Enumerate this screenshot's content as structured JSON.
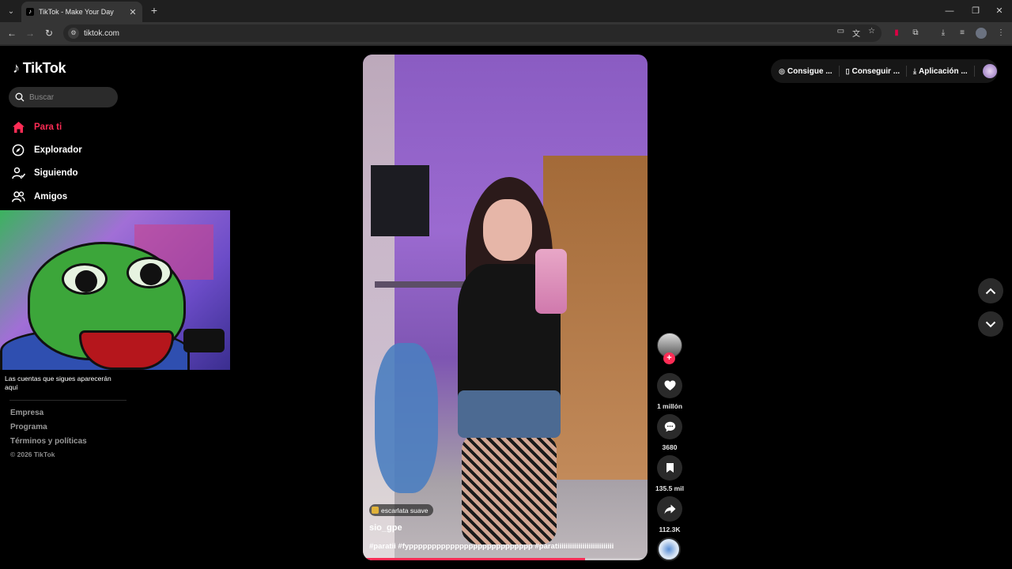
{
  "browser": {
    "tab_title": "TikTok - Make Your Day",
    "url": "tiktok.com",
    "new_tab": "+",
    "tab_close": "✕"
  },
  "sidebar": {
    "logo_text": "TikTok",
    "search_placeholder": "Buscar",
    "nav": [
      {
        "label": "Para ti",
        "icon": "home-icon",
        "active": true
      },
      {
        "label": "Explorador",
        "icon": "compass-icon",
        "active": false
      },
      {
        "label": "Siguiendo",
        "icon": "user-follow-icon",
        "active": false
      },
      {
        "label": "Amigos",
        "icon": "friends-icon",
        "active": false
      }
    ],
    "following_hint": "Las cuentas que sigues aparecerán aquí",
    "footer_links": [
      "Empresa",
      "Programa",
      "Términos y políticas"
    ],
    "copyright": "© 2026 TikTok"
  },
  "video": {
    "sound": "escarlata suave",
    "username": "sio_gpe",
    "caption": "#paratii #fyppppppppppppppppppppppppppp #paratiiiiiiiiiiiiiiiiiiiiiiiiiii",
    "progress": 0.78
  },
  "actions": {
    "likes": "1 millón",
    "comments": "3680",
    "saves": "135.5 mil",
    "shares": "112.3K",
    "follow_symbol": "+"
  },
  "topbar": {
    "coins": "Consigue ...",
    "app": "Conseguir ...",
    "download": "Aplicación ..."
  },
  "colors": {
    "accent": "#fe2c55",
    "background": "#000000"
  }
}
